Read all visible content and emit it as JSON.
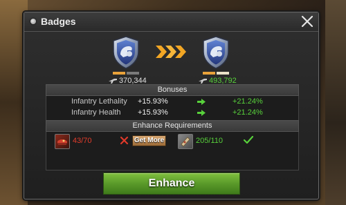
{
  "window": {
    "title": "Badges"
  },
  "current": {
    "power": "370,344"
  },
  "next": {
    "power": "493,792"
  },
  "bonuses": {
    "header": "Bonuses",
    "rows": [
      {
        "label": "Infantry Lethality",
        "current": "+15.93%",
        "next": "+21.24%"
      },
      {
        "label": "Infantry Health",
        "current": "+15.93%",
        "next": "+21.24%"
      }
    ]
  },
  "requirements": {
    "header": "Enhance Requirements",
    "item1": {
      "count": "43/70",
      "get_more_label": "Get More"
    },
    "item2": {
      "count": "205/110"
    }
  },
  "actions": {
    "enhance_label": "Enhance"
  },
  "colors": {
    "accent_green": "#58d13b",
    "insufficient_red": "#e33d2c",
    "button_green": "#5a9a2a"
  }
}
